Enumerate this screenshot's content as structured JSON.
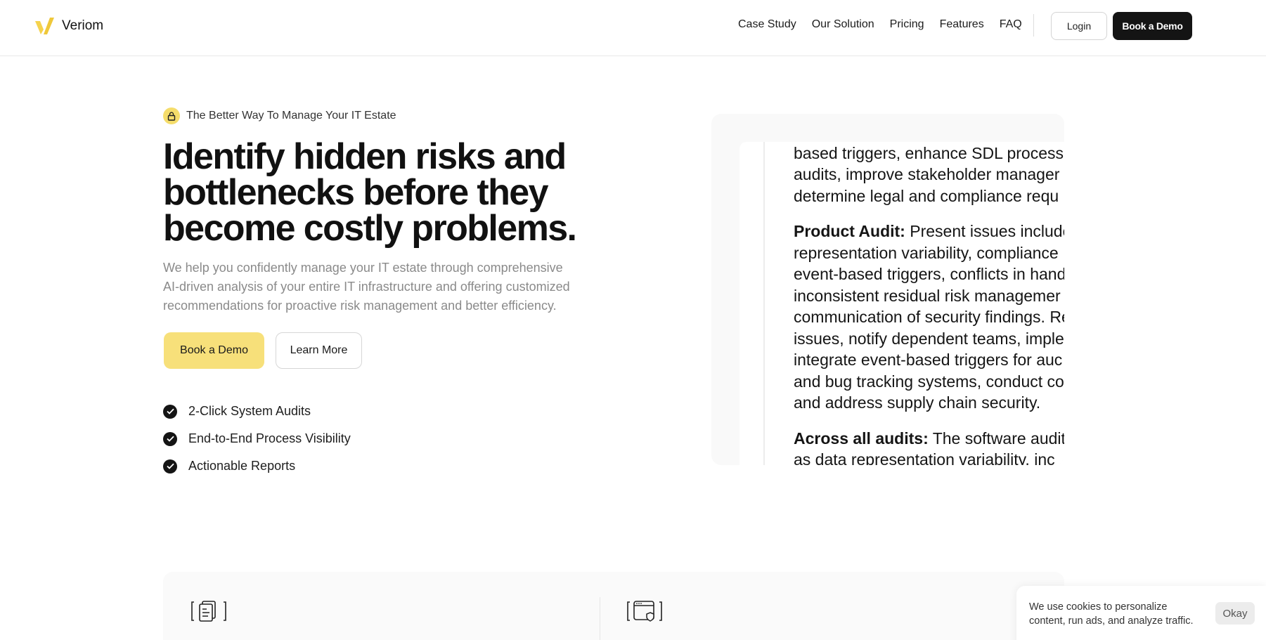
{
  "brand": {
    "name": "Veriom",
    "accent": "#F5D34E",
    "dark": "#141414"
  },
  "nav": {
    "items": [
      {
        "label": "Case Study"
      },
      {
        "label": "Our Solution"
      },
      {
        "label": "Pricing"
      },
      {
        "label": "Features"
      },
      {
        "label": "FAQ"
      }
    ],
    "login_label": "Login",
    "demo_label": "Book a Demo"
  },
  "hero": {
    "eyebrow": "The Better Way To Manage Your IT Estate",
    "eyebrow_icon": "lock-icon",
    "title_lines": [
      "Identify hidden risks and",
      "bottlenecks before they",
      "become costly problems."
    ],
    "subtitle_lines": [
      "We help you confidently manage your IT estate through comprehensive",
      "AI-driven analysis of your entire IT infrastructure and offering customized",
      "recommendations for proactive risk management and better efficiency."
    ],
    "primary_cta": "Book a Demo",
    "secondary_cta": "Learn More",
    "features": [
      {
        "label": "2-Click System Audits",
        "icon": "check-circle-icon"
      },
      {
        "label": "End-to-End Process Visibility",
        "icon": "check-circle-icon"
      },
      {
        "label": "Actionable Reports",
        "icon": "check-circle-icon"
      }
    ]
  },
  "document_preview": {
    "intro_lines": [
      "based triggers, enhance SDL process l",
      "audits, improve stakeholder manager",
      "determine legal and compliance requ"
    ],
    "product_audit": {
      "heading": "Product Audit:",
      "first_line_rest": " Present issues include c",
      "lines": [
        "representation variability, compliance",
        "event-based triggers, conflicts in hand",
        "inconsistent residual risk managemer",
        "communication of security findings. Re",
        "issues, notify dependent teams, imple",
        "integrate event-based triggers for auc",
        "and bug tracking systems, conduct co",
        "and address supply chain security."
      ]
    },
    "across_audits": {
      "heading": "Across all audits:",
      "first_line_rest": " The software audit r",
      "lines": [
        "as data representation variability, inc"
      ]
    }
  },
  "bottom": {
    "icons": [
      "document-icon",
      "browser-shield-icon"
    ]
  },
  "cookie": {
    "text": "We use cookies to personalize content, run ads, and analyze traffic.",
    "button_label": "Okay"
  }
}
